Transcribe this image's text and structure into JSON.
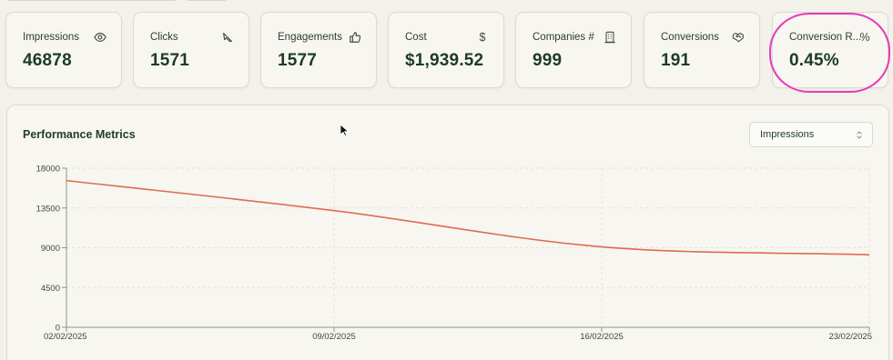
{
  "metric_cards": [
    {
      "label": "Impressions",
      "value": "46878",
      "icon": "eye-icon"
    },
    {
      "label": "Clicks",
      "value": "1571",
      "icon": "cursor-click-icon"
    },
    {
      "label": "Engagements",
      "value": "1577",
      "icon": "thumbs-up-icon"
    },
    {
      "label": "Cost",
      "value": "$1,939.52",
      "icon": "dollar-icon",
      "glyph": "$"
    },
    {
      "label": "Companies #",
      "value": "999",
      "icon": "building-icon"
    },
    {
      "label": "Conversions",
      "value": "191",
      "icon": "handshake-icon"
    },
    {
      "label": "Conversion R...",
      "value": "0.45%",
      "icon": "percent-icon",
      "glyph": "%"
    }
  ],
  "highlight": {
    "target": "Conversion R...",
    "color": "#e73ab9"
  },
  "performance": {
    "title": "Performance Metrics",
    "metric_select": {
      "selected": "Impressions"
    }
  },
  "chart_data": {
    "type": "line",
    "title": "",
    "xlabel": "",
    "ylabel": "",
    "x_ticks": [
      "02/02/2025",
      "09/02/2025",
      "16/02/2025",
      "23/02/2025"
    ],
    "y_ticks": [
      0,
      4500,
      9000,
      13500,
      18000
    ],
    "ylim": [
      0,
      18000
    ],
    "grid": true,
    "series": [
      {
        "color": "#e06a50",
        "points": [
          {
            "x": "02/02/2025",
            "y": 16600
          },
          {
            "x": "09/02/2025",
            "y": 13200
          },
          {
            "x": "16/02/2025",
            "y": 9100
          },
          {
            "x": "23/02/2025",
            "y": 8200
          }
        ]
      }
    ]
  },
  "colors": {
    "background": "#f2f1ea",
    "card": "#f7f6f0",
    "text_primary": "#1d3b2b",
    "line": "#e06a50",
    "grid": "#e4e3d9"
  }
}
